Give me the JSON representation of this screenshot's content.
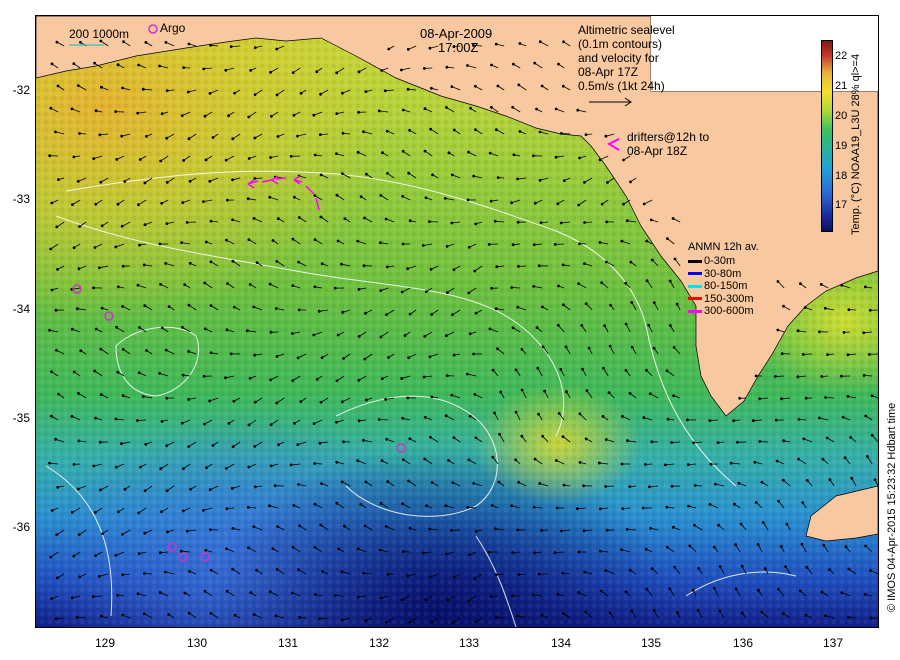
{
  "header": {
    "date": "08-Apr-2009",
    "time": "17:00Z"
  },
  "scale": {
    "label": "200  1000m",
    "argo_label": "Argo"
  },
  "altimetry_note": {
    "line1": "Altimetric sealevel",
    "line2": "(0.1m contours)",
    "line3": "and velocity for",
    "line4": "08-Apr 17Z",
    "line5": "0.5m/s (1kt 24h)"
  },
  "drifters_note": {
    "line1": "drifters@12h to",
    "line2": "08-Apr 18Z"
  },
  "anmn_legend": {
    "title": "ANMN 12h av.",
    "items": [
      {
        "label": "0-30m",
        "color": "#000000"
      },
      {
        "label": "30-80m",
        "color": "#0000ff"
      },
      {
        "label": "80-150m",
        "color": "#00e5e5"
      },
      {
        "label": "150-300m",
        "color": "#ff0000"
      },
      {
        "label": "300-600m",
        "color": "#ff00ff"
      }
    ]
  },
  "colorbar": {
    "ticks": [
      "22",
      "21",
      "20",
      "19",
      "18",
      "17"
    ],
    "label": "Temp. (°C) NOAA19_L3U 28% ql>=4"
  },
  "axes": {
    "lat_ticks": [
      "-32",
      "-33",
      "-34",
      "-35",
      "-36"
    ],
    "lon_ticks": [
      "129",
      "130",
      "131",
      "132",
      "133",
      "134",
      "135",
      "136",
      "137"
    ]
  },
  "credit": "© IMOS 04-Apr-2015 15:23:32 Hdbart time",
  "colors": {
    "land": "#f8c8a0",
    "argo_marker": "#cc33cc",
    "drifter": "#ff00ff",
    "contour": "#ffffff",
    "scale_line": "#00c0c0"
  }
}
